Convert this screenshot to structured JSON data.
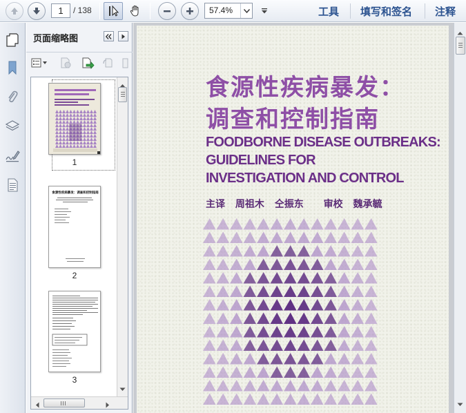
{
  "toolbar": {
    "page_current": "1",
    "page_total": "/ 138",
    "zoom": "57.4%",
    "menu": [
      "工具",
      "填写和签名",
      "注释"
    ]
  },
  "panel": {
    "title": "页面缩略图",
    "thumbnails": [
      {
        "number": "1"
      },
      {
        "number": "2"
      },
      {
        "number": "3"
      }
    ]
  },
  "cover": {
    "title_cn_line1": "食源性疾病暴发：",
    "title_cn_line2": "调查和控制指南",
    "title_en_line1": "FOODBORNE DISEASE OUTBREAKS:",
    "title_en_line2": "GUIDELINES FOR",
    "title_en_line3": "INVESTIGATION AND CONTROL",
    "credits": [
      "主译",
      "周祖木",
      "仝振东",
      "审校",
      "魏承毓"
    ],
    "colors": {
      "title": "#8e4fa6",
      "pattern_light": "#a784c4",
      "pattern_dark": "#5b2a80"
    }
  },
  "thumb2_heading": "食源性疾病暴发：调查和控制指南"
}
